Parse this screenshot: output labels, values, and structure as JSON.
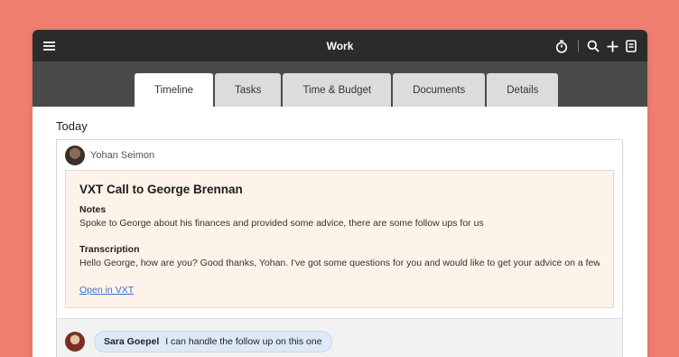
{
  "window": {
    "title": "Work"
  },
  "header": {
    "icons": [
      "menu-icon",
      "timer-icon",
      "search-icon",
      "plus-icon",
      "notes-icon"
    ]
  },
  "tabs": [
    {
      "label": "Timeline",
      "active": true
    },
    {
      "label": "Tasks",
      "active": false
    },
    {
      "label": "Time & Budget",
      "active": false
    },
    {
      "label": "Documents",
      "active": false
    },
    {
      "label": "Details",
      "active": false
    }
  ],
  "timeline": {
    "date_heading": "Today",
    "entry": {
      "author": "Yohan Seimon",
      "title": "VXT Call to George Brennan",
      "notes_label": "Notes",
      "notes_text": "Spoke to George about his finances and provided some advice, there are some follow ups for us",
      "transcription_label": "Transcription",
      "transcription_text": "Hello George, how are you? Good thanks, Yohan. I've got some questions for you and would like to get your advice on a few...",
      "link_label": "Open in VXT"
    },
    "comment": {
      "author": "Sara Goepel",
      "text": "I can handle the follow up on this one"
    }
  },
  "colors": {
    "background": "#f07f70",
    "titlebar": "#2b2b2b",
    "tabbar": "#4a4a4a",
    "note_bg": "#fdf3e8",
    "link": "#3b6fd1",
    "bubble": "#dde9f7"
  }
}
